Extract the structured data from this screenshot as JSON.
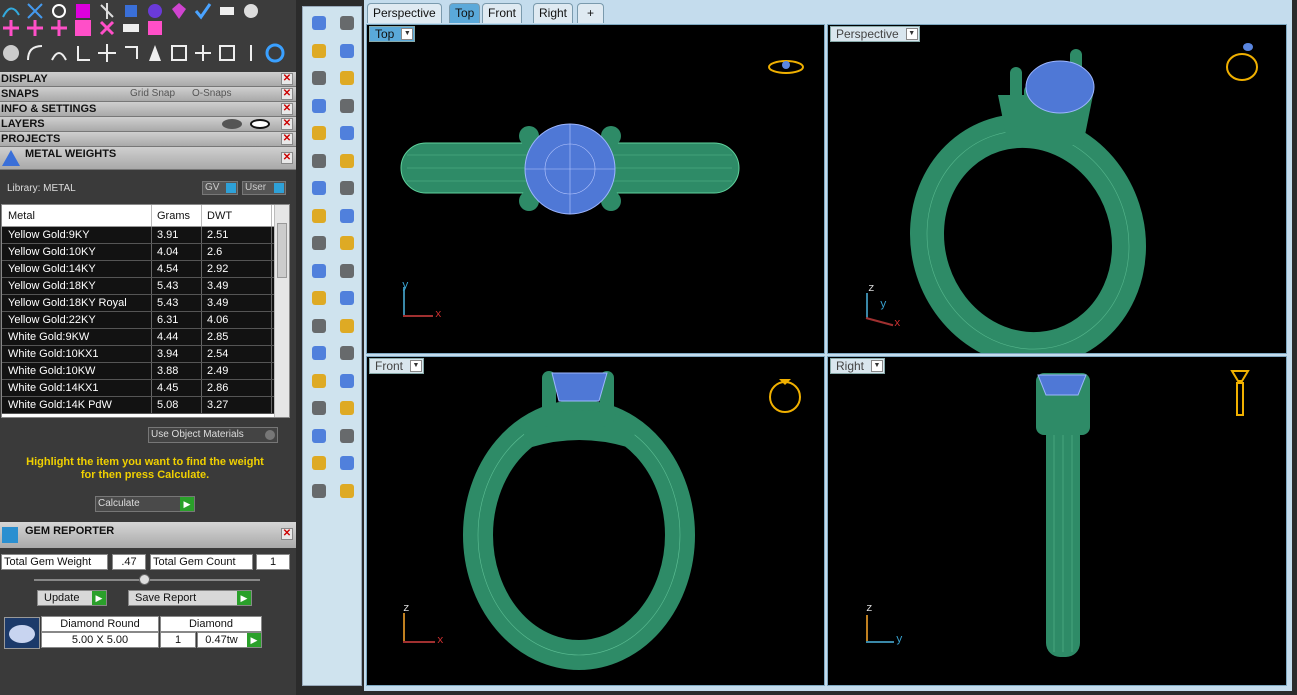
{
  "left_panel": {
    "headers": {
      "display": "DISPLAY",
      "snaps": "SNAPS",
      "grid_snap": "Grid Snap",
      "o_snaps": "O-Snaps",
      "info_settings": "INFO & SETTINGS",
      "layers": "LAYERS",
      "projects": "PROJECTS",
      "metal_weights": "METAL WEIGHTS"
    },
    "close_glyph": "✕",
    "metal_weights": {
      "library_label": "Library: METAL",
      "gv_label": "GV",
      "user_label": "User",
      "columns": [
        "Metal",
        "Grams",
        "DWT"
      ],
      "rows": [
        [
          "Yellow Gold:9KY",
          "3.91",
          "2.51"
        ],
        [
          "Yellow Gold:10KY",
          "4.04",
          "2.6"
        ],
        [
          "Yellow Gold:14KY",
          "4.54",
          "2.92"
        ],
        [
          "Yellow Gold:18KY",
          "5.43",
          "3.49"
        ],
        [
          "Yellow Gold:18KY Royal",
          "5.43",
          "3.49"
        ],
        [
          "Yellow Gold:22KY",
          "6.31",
          "4.06"
        ],
        [
          "White Gold:9KW",
          "4.44",
          "2.85"
        ],
        [
          "White Gold:10KX1",
          "3.94",
          "2.54"
        ],
        [
          "White Gold:10KW",
          "3.88",
          "2.49"
        ],
        [
          "White Gold:14KX1",
          "4.45",
          "2.86"
        ],
        [
          "White Gold:14K PdW",
          "5.08",
          "3.27"
        ]
      ],
      "use_object_materials": "Use Object Materials",
      "hint_line1": "Highlight the item you want to find the weight",
      "hint_line2": "for then press Calculate.",
      "calculate": "Calculate"
    },
    "gem_reporter": {
      "title": "GEM REPORTER",
      "total_gem_weight_label": "Total Gem Weight",
      "total_gem_weight": ".47",
      "total_gem_count_label": "Total Gem Count",
      "total_gem_count": "1",
      "update": "Update",
      "save_report": "Save Report",
      "gem": {
        "cut": "Diamond Round",
        "type": "Diamond",
        "size": "5.00 X 5.00",
        "count": "1",
        "weight": "0.47tw"
      }
    }
  },
  "tabs": [
    "Perspective",
    "Top",
    "Front",
    "Right",
    "+"
  ],
  "active_tab": "Top",
  "viewports": {
    "top": {
      "label": "Top"
    },
    "perspective": {
      "label": "Perspective"
    },
    "front": {
      "label": "Front"
    },
    "right": {
      "label": "Right"
    }
  },
  "axes": {
    "x": "x",
    "y": "y",
    "z": "z"
  },
  "colors": {
    "metal": "#2e8b67",
    "gem": "#4f78d6",
    "viewport_bg": "#000000",
    "frame": "#c4dced",
    "active_tab": "#5aa9da",
    "hint": "#f0d000"
  }
}
